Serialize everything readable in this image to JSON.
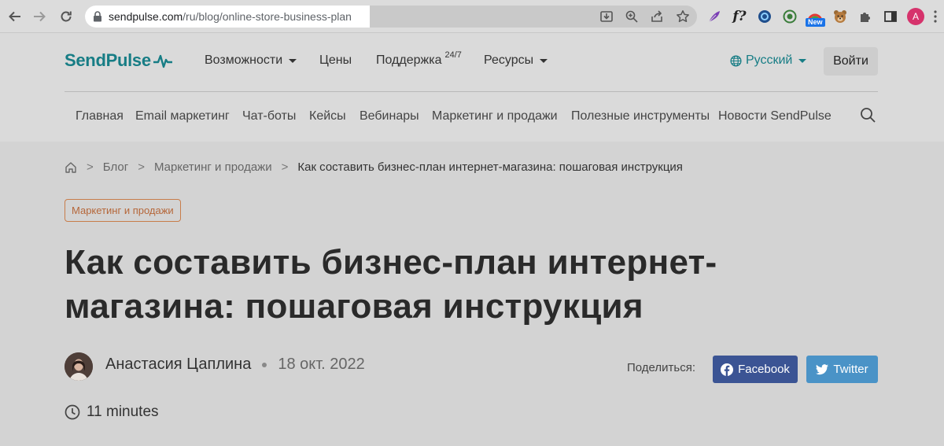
{
  "browser": {
    "url_host": "sendpulse.com",
    "url_path": "/ru/blog/online-store-business-plan",
    "new_badge": "New",
    "profile_initial": "A",
    "extensions": [
      "feather-icon",
      "fx-icon",
      "aperture-icon",
      "record-icon",
      "color-wheel-icon",
      "bear-icon",
      "puzzle-icon",
      "sidepanel-icon"
    ]
  },
  "header": {
    "logo": "SendPulse",
    "menu": {
      "features": "Возможности",
      "prices": "Цены",
      "support": "Поддержка",
      "support_sup": "24/7",
      "resources": "Ресурсы"
    },
    "language": "Русский",
    "login": "Войти"
  },
  "subnav": [
    "Главная",
    "Email маркетинг",
    "Чат-боты",
    "Кейсы",
    "Вебинары",
    "Маркетинг и продажи",
    "Полезные инструменты",
    "Новости SendPulse"
  ],
  "breadcrumb": {
    "items": [
      "Блог",
      "Маркетинг и продажи"
    ],
    "current": "Как составить бизнес-план интернет-магазина: пошаговая инструкция",
    "separator": ">"
  },
  "article": {
    "category": "Маркетинг и продажи",
    "title_line1": "Как составить бизнес-план интернет-",
    "title_line2": "магазина: пошаговая инструкция",
    "author": "Анастасия Цаплина",
    "date": "18 окт. 2022",
    "share_label": "Поделиться:",
    "facebook": "Facebook",
    "twitter": "Twitter",
    "read_time": "11 minutes"
  }
}
